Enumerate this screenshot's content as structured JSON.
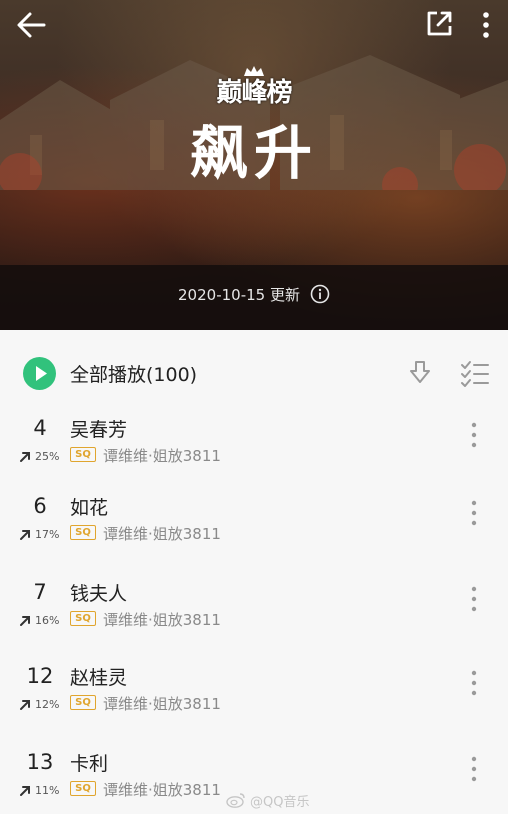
{
  "header": {
    "logo_text": "巅峰榜",
    "title": "飙升",
    "update_text": "2020-10-15 更新"
  },
  "toolbar": {
    "play_all_label": "全部播放(100)"
  },
  "songs": [
    {
      "rank": "4",
      "trend": "25%",
      "title": "吴春芳",
      "quality": "SQ",
      "artist_album": "谭维维·姐放3811"
    },
    {
      "rank": "6",
      "trend": "17%",
      "title": "如花",
      "quality": "SQ",
      "artist_album": "谭维维·姐放3811"
    },
    {
      "rank": "7",
      "trend": "16%",
      "title": "钱夫人",
      "quality": "SQ",
      "artist_album": "谭维维·姐放3811"
    },
    {
      "rank": "12",
      "trend": "12%",
      "title": "赵桂灵",
      "quality": "SQ",
      "artist_album": "谭维维·姐放3811"
    },
    {
      "rank": "13",
      "trend": "11%",
      "title": "卡利",
      "quality": "SQ",
      "artist_album": "谭维维·姐放3811"
    }
  ],
  "watermark": {
    "text": "@QQ音乐"
  },
  "icons": {
    "back": "back-arrow-icon",
    "share": "share-icon",
    "more": "more-vertical-icon",
    "info": "info-icon",
    "play": "play-icon",
    "download": "download-icon",
    "multiselect": "multiselect-icon",
    "trend_up": "trend-up-icon"
  },
  "colors": {
    "accent": "#31c27c",
    "sq_badge": "#e0a52e",
    "text_primary": "#222222",
    "text_secondary": "#8a8a8a"
  }
}
